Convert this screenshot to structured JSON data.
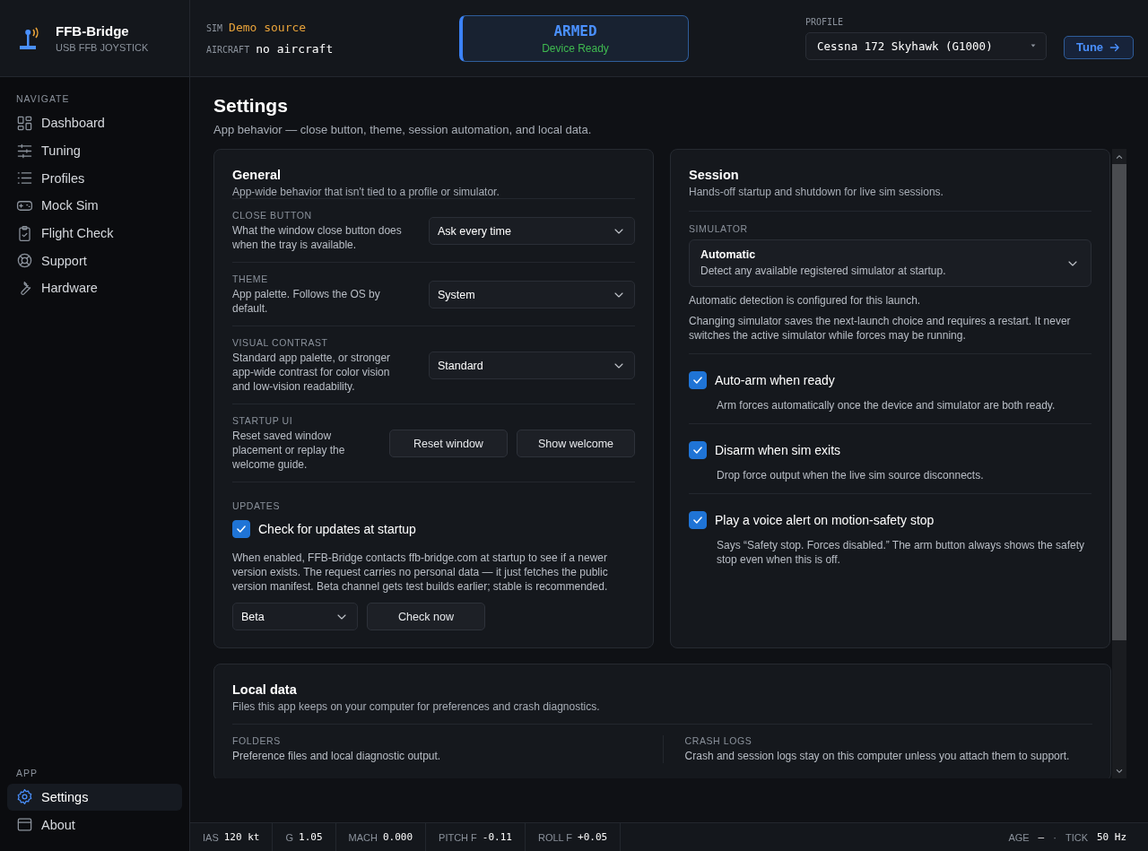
{
  "brand": {
    "title": "FFB-Bridge",
    "subtitle": "USB FFB JOYSTICK"
  },
  "sidebar": {
    "sections": [
      {
        "heading": "NAVIGATE",
        "items": [
          {
            "label": "Dashboard",
            "selected": false
          },
          {
            "label": "Tuning",
            "selected": false
          },
          {
            "label": "Profiles",
            "selected": false
          },
          {
            "label": "Mock Sim",
            "selected": false
          },
          {
            "label": "Flight Check",
            "selected": false
          },
          {
            "label": "Support",
            "selected": false
          },
          {
            "label": "Hardware",
            "selected": false
          }
        ]
      },
      {
        "heading": "APP",
        "items": [
          {
            "label": "Settings",
            "selected": true
          },
          {
            "label": "About",
            "selected": false
          }
        ]
      }
    ]
  },
  "header": {
    "sources": [
      {
        "label": "SIM",
        "value": "Demo source",
        "kind": "warn"
      },
      {
        "label": "AIRCRAFT",
        "value": "no aircraft",
        "kind": "plain"
      }
    ],
    "status": {
      "title": "ARMED",
      "subtitle": "Device Ready"
    },
    "profile": {
      "label": "PROFILE",
      "value": "Cessna 172 Skyhawk (G1000)"
    },
    "tune_button": "Tune"
  },
  "page": {
    "title": "Settings",
    "subtitle": "App behavior — close button, theme, session automation, and local data."
  },
  "general": {
    "title": "General",
    "subtitle": "App-wide behavior that isn't tied to a profile or simulator.",
    "rows": [
      {
        "label": "CLOSE BUTTON",
        "description": "What the window close button does when the tray is available.",
        "kind": "select",
        "value": "Ask every time"
      },
      {
        "label": "THEME",
        "description": "App palette. Follows the OS by default.",
        "kind": "select",
        "value": "System"
      },
      {
        "label": "VISUAL CONTRAST",
        "description": "Standard app palette, or stronger app-wide contrast for color vision and low-vision readability.",
        "kind": "select",
        "value": "Standard"
      },
      {
        "label": "STARTUP UI",
        "description": "Reset saved window placement or replay the welcome guide.",
        "kind": "buttons",
        "buttons": [
          "Reset window",
          "Show welcome"
        ]
      }
    ],
    "updates": {
      "label": "UPDATES",
      "checkbox": {
        "label": "Check for updates at startup",
        "checked": true
      },
      "description": "When enabled, FFB-Bridge contacts ffb-bridge.com at startup to see if a newer version exists. The request carries no personal data — it just fetches the public version manifest. Beta channel gets test builds earlier; stable is recommended.",
      "channel": "Beta",
      "button": "Check now"
    }
  },
  "session": {
    "title": "Session",
    "subtitle": "Hands-off startup and shutdown for live sim sessions.",
    "simulator_label": "SIMULATOR",
    "simulator": {
      "value": "Automatic",
      "description": "Detect any available registered simulator at startup."
    },
    "notes": [
      "Automatic detection is configured for this launch.",
      "Changing simulator saves the next-launch choice and requires a restart. It never switches the active simulator while forces may be running."
    ],
    "options": [
      {
        "label": "Auto-arm when ready",
        "checked": true,
        "description": "Arm forces automatically once the device and simulator are both ready."
      },
      {
        "label": "Disarm when sim exits",
        "checked": true,
        "description": "Drop force output when the live sim source disconnects."
      },
      {
        "label": "Play a voice alert on motion-safety stop",
        "checked": true,
        "description": "Says “Safety stop. Forces disabled.” The arm button always shows the safety stop even when this is off."
      }
    ]
  },
  "local_data": {
    "title": "Local data",
    "subtitle": "Files this app keeps on your computer for preferences and crash diagnostics.",
    "columns": [
      {
        "label": "FOLDERS",
        "description": "Preference files and local diagnostic output."
      },
      {
        "label": "CRASH LOGS",
        "description": "Crash and session logs stay on this computer unless you attach them to support."
      }
    ]
  },
  "status_bar": {
    "readouts": [
      {
        "label": "IAS",
        "value": "120 kt"
      },
      {
        "label": "G",
        "value": "1.05"
      },
      {
        "label": "MACH",
        "value": "0.000"
      },
      {
        "label": "PITCH F",
        "value": "-0.11"
      },
      {
        "label": "ROLL F",
        "value": "+0.05"
      }
    ],
    "right": [
      {
        "label": "AGE",
        "value": "—"
      },
      {
        "label": "TICK",
        "value": "50 Hz"
      }
    ],
    "separator": "·"
  }
}
